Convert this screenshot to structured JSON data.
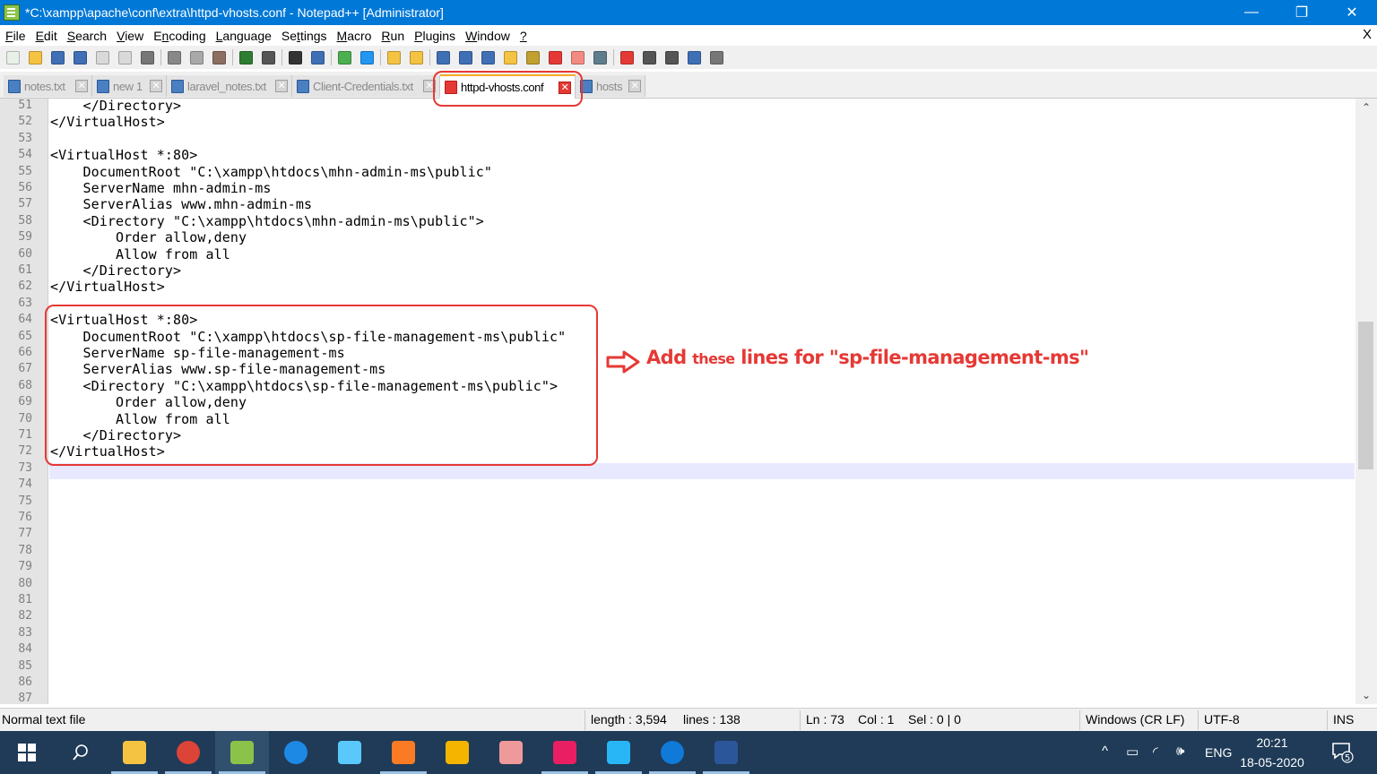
{
  "window": {
    "title": "*C:\\xampp\\apache\\conf\\extra\\httpd-vhosts.conf - Notepad++ [Administrator]",
    "buttons": {
      "minimize": "—",
      "maximize": "❐",
      "close": "✕"
    }
  },
  "menu": {
    "items": [
      {
        "prefix": "",
        "ul": "F",
        "rest": "ile"
      },
      {
        "prefix": "",
        "ul": "E",
        "rest": "dit"
      },
      {
        "prefix": "",
        "ul": "S",
        "rest": "earch"
      },
      {
        "prefix": "",
        "ul": "V",
        "rest": "iew"
      },
      {
        "prefix": "E",
        "ul": "n",
        "rest": "coding"
      },
      {
        "prefix": "",
        "ul": "L",
        "rest": "anguage"
      },
      {
        "prefix": "Se",
        "ul": "t",
        "rest": "tings"
      },
      {
        "prefix": "",
        "ul": "M",
        "rest": "acro"
      },
      {
        "prefix": "",
        "ul": "R",
        "rest": "un"
      },
      {
        "prefix": "",
        "ul": "P",
        "rest": "lugins"
      },
      {
        "prefix": "",
        "ul": "W",
        "rest": "indow"
      },
      {
        "prefix": "",
        "ul": "?",
        "rest": ""
      }
    ],
    "close": "X"
  },
  "toolbar": {
    "icons": [
      {
        "name": "new-file-icon",
        "color": "#e8f0e8"
      },
      {
        "name": "open-file-icon",
        "color": "#f5c342"
      },
      {
        "name": "save-icon",
        "color": "#3f6fb5"
      },
      {
        "name": "save-all-icon",
        "color": "#3f6fb5"
      },
      {
        "name": "close-icon",
        "color": "#d9d9d9"
      },
      {
        "name": "close-all-icon",
        "color": "#d9d9d9"
      },
      {
        "name": "print-icon",
        "color": "#777777"
      },
      {
        "name": "sep",
        "color": ""
      },
      {
        "name": "cut-icon",
        "color": "#888888"
      },
      {
        "name": "copy-icon",
        "color": "#a9a9a9"
      },
      {
        "name": "paste-icon",
        "color": "#8d6e63"
      },
      {
        "name": "sep",
        "color": ""
      },
      {
        "name": "undo-icon",
        "color": "#2e7d32"
      },
      {
        "name": "redo-icon",
        "color": "#555555"
      },
      {
        "name": "sep",
        "color": ""
      },
      {
        "name": "find-icon",
        "color": "#333333"
      },
      {
        "name": "replace-icon",
        "color": "#3f6fb5"
      },
      {
        "name": "sep",
        "color": ""
      },
      {
        "name": "zoom-in-icon",
        "color": "#4caf50"
      },
      {
        "name": "zoom-out-icon",
        "color": "#2196f3"
      },
      {
        "name": "sep",
        "color": ""
      },
      {
        "name": "sync-vertical-icon",
        "color": "#f5c342"
      },
      {
        "name": "sync-horizontal-icon",
        "color": "#f5c342"
      },
      {
        "name": "sep",
        "color": ""
      },
      {
        "name": "word-wrap-icon",
        "color": "#3f6fb5"
      },
      {
        "name": "show-all-chars-icon",
        "color": "#3f6fb5"
      },
      {
        "name": "indent-guide-icon",
        "color": "#3f6fb5"
      },
      {
        "name": "define-language-icon",
        "color": "#f5c342"
      },
      {
        "name": "doc-map-icon",
        "color": "#c0a030"
      },
      {
        "name": "function-list-icon",
        "color": "#e53935"
      },
      {
        "name": "folder-workspace-icon",
        "color": "#f28b82"
      },
      {
        "name": "monitoring-icon",
        "color": "#607d8b"
      },
      {
        "name": "sep",
        "color": ""
      },
      {
        "name": "record-macro-icon",
        "color": "#e53935"
      },
      {
        "name": "stop-record-icon",
        "color": "#555555"
      },
      {
        "name": "play-macro-icon",
        "color": "#555555"
      },
      {
        "name": "run-macro-multiple-icon",
        "color": "#3f6fb5"
      },
      {
        "name": "save-macro-icon",
        "color": "#777777"
      }
    ]
  },
  "tabs": [
    {
      "label": "notes.txt",
      "close": "✕",
      "active": false
    },
    {
      "label": "new 1",
      "close": "✕",
      "active": false
    },
    {
      "label": "laravel_notes.txt",
      "close": "✕",
      "active": false
    },
    {
      "label": "Client-Credentials.txt",
      "close": "✕",
      "active": false
    },
    {
      "label": "httpd-vhosts.conf",
      "close": "✕",
      "active": true
    },
    {
      "label": "hosts",
      "close": "✕",
      "active": false
    }
  ],
  "editor": {
    "lines": [
      {
        "num": "51",
        "text": "    </Directory>"
      },
      {
        "num": "52",
        "text": "</VirtualHost>"
      },
      {
        "num": "53",
        "text": ""
      },
      {
        "num": "54",
        "text": "<VirtualHost *:80>"
      },
      {
        "num": "55",
        "text": "    DocumentRoot \"C:\\xampp\\htdocs\\mhn-admin-ms\\public\""
      },
      {
        "num": "56",
        "text": "    ServerName mhn-admin-ms"
      },
      {
        "num": "57",
        "text": "    ServerAlias www.mhn-admin-ms"
      },
      {
        "num": "58",
        "text": "    <Directory \"C:\\xampp\\htdocs\\mhn-admin-ms\\public\">"
      },
      {
        "num": "59",
        "text": "        Order allow,deny"
      },
      {
        "num": "60",
        "text": "        Allow from all"
      },
      {
        "num": "61",
        "text": "    </Directory>"
      },
      {
        "num": "62",
        "text": "</VirtualHost>"
      },
      {
        "num": "63",
        "text": ""
      },
      {
        "num": "64",
        "text": "<VirtualHost *:80>"
      },
      {
        "num": "65",
        "text": "    DocumentRoot \"C:\\xampp\\htdocs\\sp-file-management-ms\\public\""
      },
      {
        "num": "66",
        "text": "    ServerName sp-file-management-ms"
      },
      {
        "num": "67",
        "text": "    ServerAlias www.sp-file-management-ms"
      },
      {
        "num": "68",
        "text": "    <Directory \"C:\\xampp\\htdocs\\sp-file-management-ms\\public\">"
      },
      {
        "num": "69",
        "text": "        Order allow,deny"
      },
      {
        "num": "70",
        "text": "        Allow from all"
      },
      {
        "num": "71",
        "text": "    </Directory>"
      },
      {
        "num": "72",
        "text": "</VirtualHost>"
      },
      {
        "num": "73",
        "text": ""
      },
      {
        "num": "74",
        "text": ""
      },
      {
        "num": "75",
        "text": ""
      },
      {
        "num": "76",
        "text": ""
      },
      {
        "num": "77",
        "text": ""
      },
      {
        "num": "78",
        "text": ""
      },
      {
        "num": "79",
        "text": ""
      },
      {
        "num": "80",
        "text": ""
      },
      {
        "num": "81",
        "text": ""
      },
      {
        "num": "82",
        "text": ""
      },
      {
        "num": "83",
        "text": ""
      },
      {
        "num": "84",
        "text": ""
      },
      {
        "num": "85",
        "text": ""
      },
      {
        "num": "86",
        "text": ""
      },
      {
        "num": "87",
        "text": ""
      }
    ],
    "current_line": "73"
  },
  "annotation": {
    "part1": "Add ",
    "part2": "these",
    "part3": " lines for \"sp-file-management-ms\"",
    "color": "#e53935"
  },
  "scrollbar": {
    "up": "⌃",
    "down": "⌄"
  },
  "status": {
    "file_type": "Normal text file",
    "length": "length : 3,594",
    "lines": "lines : 138",
    "ln": "Ln : 73",
    "col": "Col : 1",
    "sel": "Sel : 0 | 0",
    "eol": "Windows (CR LF)",
    "encoding": "UTF-8",
    "mode": "INS"
  },
  "taskbar": {
    "apps": [
      {
        "name": "start-button",
        "color": "#ffffff"
      },
      {
        "name": "search-button",
        "color": ""
      },
      {
        "name": "file-explorer-app",
        "color": "#f5c342"
      },
      {
        "name": "chrome-app",
        "color": "#db4437"
      },
      {
        "name": "notepad-plus-plus-app",
        "color": "#8bc34a"
      },
      {
        "name": "maps-app",
        "color": "#1e88e5"
      },
      {
        "name": "notepad-app",
        "color": "#5ac8fa"
      },
      {
        "name": "xampp-app",
        "color": "#fb7a24"
      },
      {
        "name": "git-app",
        "color": "#f4b400"
      },
      {
        "name": "paint-app",
        "color": "#ef9a9a"
      },
      {
        "name": "snip-app",
        "color": "#e91e63"
      },
      {
        "name": "photos-app",
        "color": "#29b6f6"
      },
      {
        "name": "edge-app",
        "color": "#0f7ad8"
      },
      {
        "name": "word-app",
        "color": "#2b579a"
      }
    ],
    "tray": {
      "chevron": "^",
      "language": "ENG",
      "time": "20:21",
      "date": "18-05-2020",
      "notifications": "5"
    }
  }
}
